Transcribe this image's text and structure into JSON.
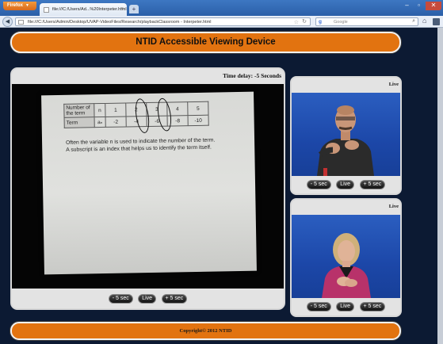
{
  "browser": {
    "app_button": "Firefox",
    "tab_title": "file:///C:/Users/Ad...%20Interpeter.html",
    "url": "file:///C:/Users/Admin/Desktop/UVAP-VideoFiles/Research/playbackClassroom - Interpeter.html",
    "search_engine": "Google",
    "search_placeholder": "Google",
    "new_tab": "+"
  },
  "header": {
    "title": "NTID Accessible Viewing Device"
  },
  "main_video": {
    "time_delay": "Time delay: -5 Seconds",
    "board": {
      "table": {
        "row1": [
          "Number of the term",
          "n",
          "1",
          "2",
          "3",
          "4",
          "5"
        ],
        "row2": [
          "Term",
          "aₙ",
          "-2",
          "-4",
          "-6",
          "-8",
          "-10"
        ]
      },
      "line1": "Often the variable n is used to indicate the number of the term.",
      "line2": "A subscript is an index that helps us to identify the term itself."
    },
    "controls": {
      "back": "- 5 sec",
      "live": "Live",
      "forward": "+ 5 sec"
    }
  },
  "interpreters": [
    {
      "label": "Live",
      "controls": {
        "back": "- 5 sec",
        "live": "Live",
        "forward": "+ 5 sec"
      }
    },
    {
      "label": "Live",
      "controls": {
        "back": "- 5 sec",
        "live": "Live",
        "forward": "+ 5 sec"
      }
    }
  ],
  "footer": {
    "text": "Copyright© 2012 NTID"
  },
  "colors": {
    "accent_orange": "#e27310",
    "page_background": "#0c1a33",
    "panel_grey": "#e3e3e3",
    "video_blue": "#2b5ec0"
  }
}
